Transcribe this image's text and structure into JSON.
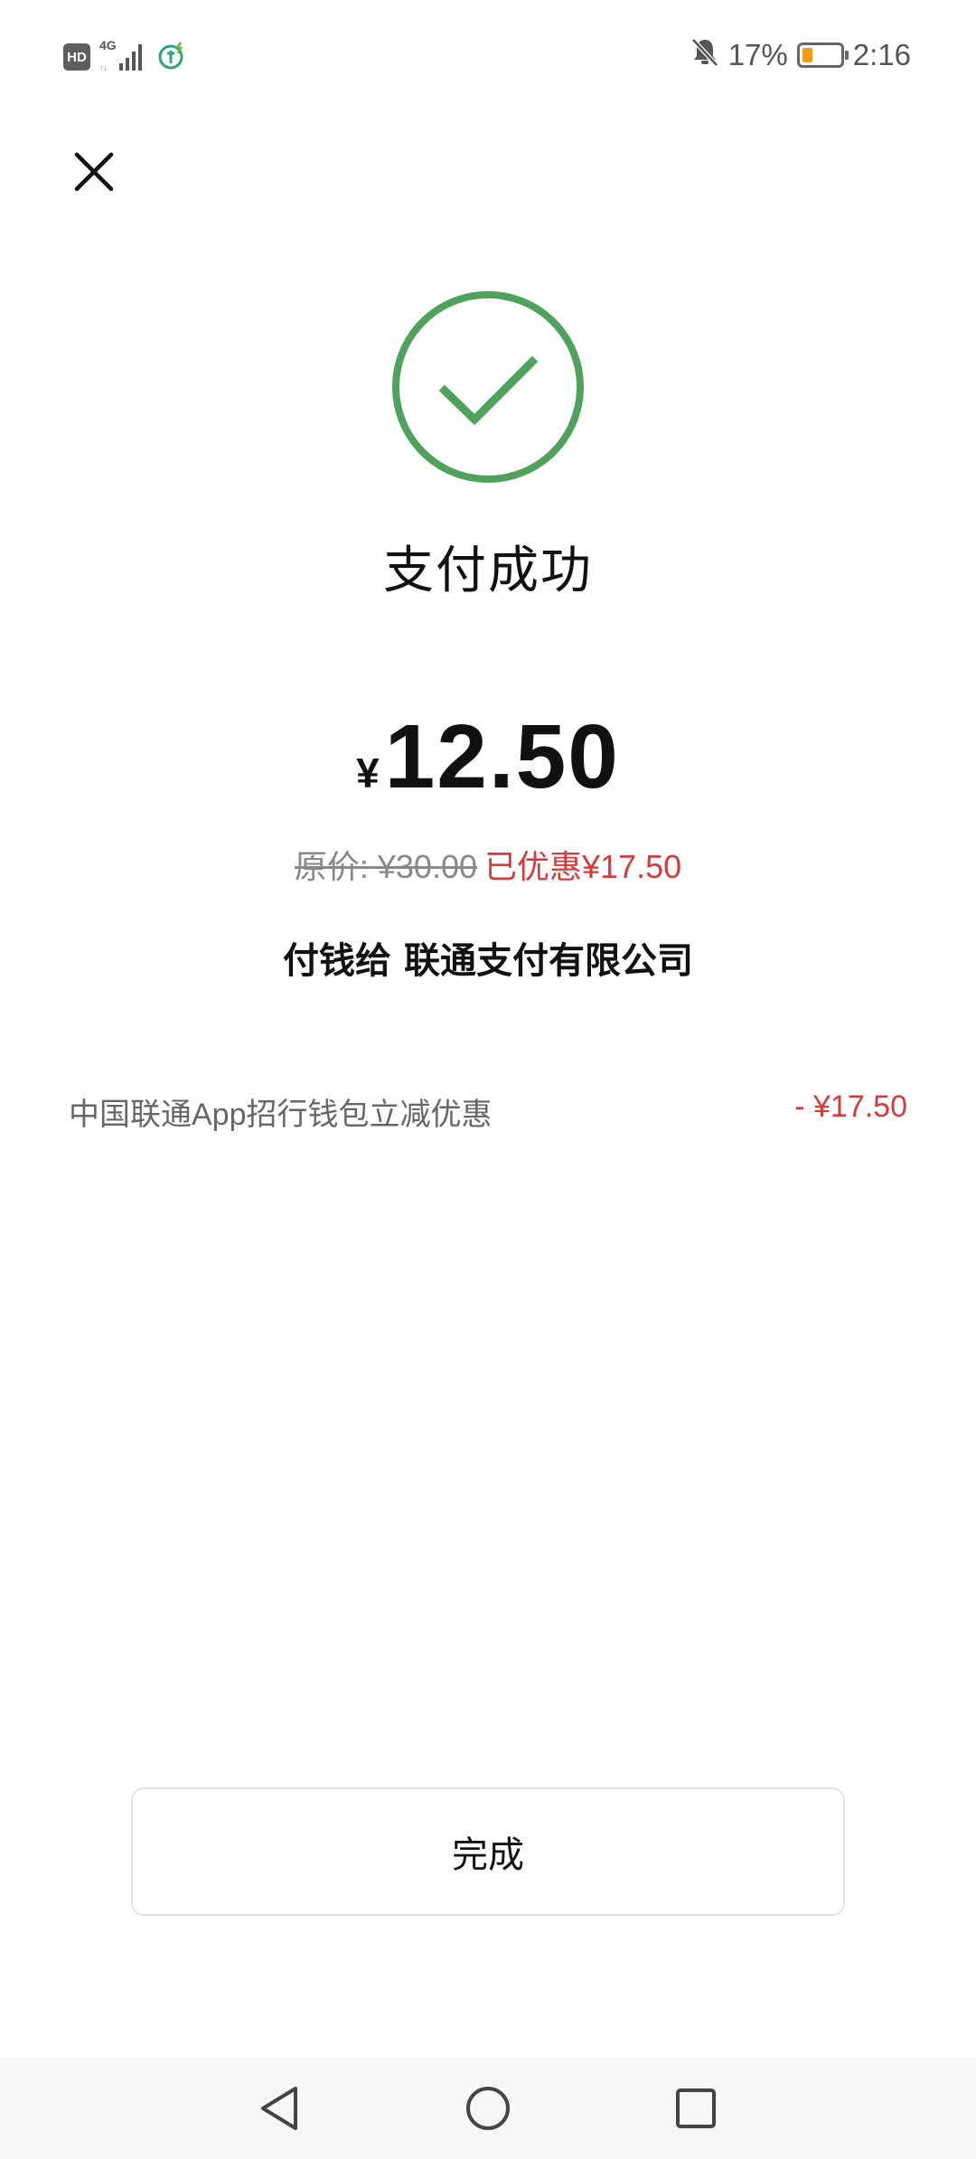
{
  "status_bar": {
    "hd_badge": "HD",
    "network": "4G",
    "battery_percent": "17%",
    "battery_level": 0.17,
    "time": "2:16",
    "icons": [
      "hd-icon",
      "signal-icon",
      "charging-app-icon",
      "bell-muted-icon",
      "battery-icon"
    ]
  },
  "header": {
    "close_icon": "close-icon"
  },
  "result": {
    "icon": "checkmark-circle-icon",
    "title": "支付成功",
    "currency": "¥",
    "amount": "12.50",
    "original_price": "原价: ¥30.00",
    "discount_text": "已优惠¥17.50",
    "payee": "付钱给 联通支付有限公司"
  },
  "discount_detail": {
    "label": "中国联通App招行钱包立减优惠",
    "value": "- ¥17.50"
  },
  "actions": {
    "done_label": "完成"
  },
  "colors": {
    "success_green": "#4fa25c",
    "discount_red": "#d8393b",
    "battery_orange": "#f39a1e"
  },
  "nav_bar": {
    "items": [
      "back-icon",
      "home-icon",
      "recents-icon"
    ]
  }
}
